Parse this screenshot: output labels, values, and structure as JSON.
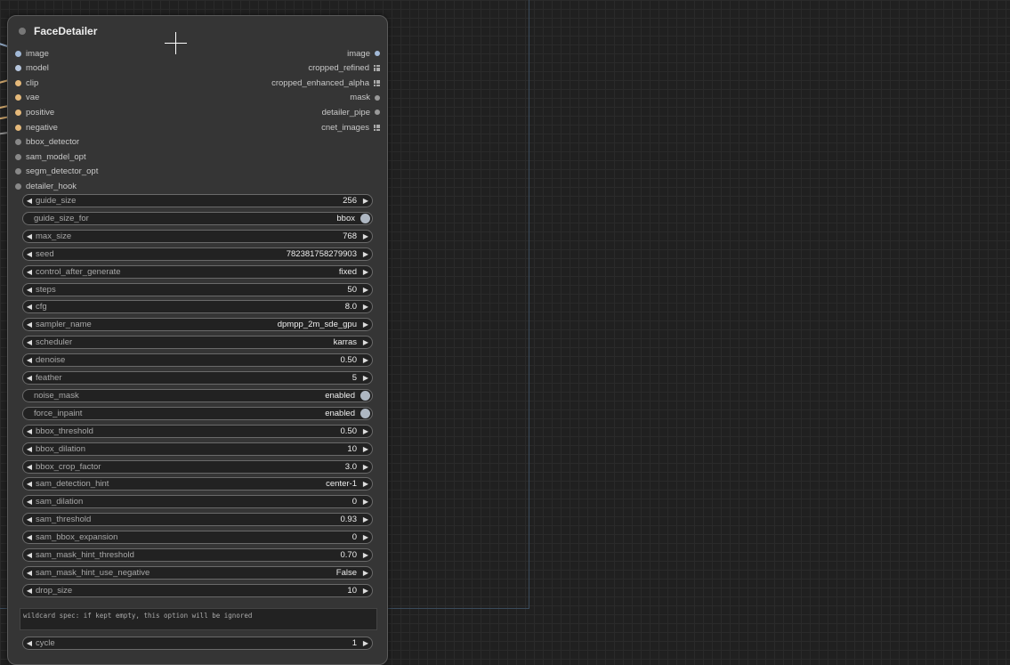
{
  "node": {
    "title": "FaceDetailer",
    "inputs": [
      {
        "label": "image",
        "color": "#a1b8d6"
      },
      {
        "label": "model",
        "color": "#b6c6dd"
      },
      {
        "label": "clip",
        "color": "#e5b97a"
      },
      {
        "label": "vae",
        "color": "#e5b97a"
      },
      {
        "label": "positive",
        "color": "#e5b97a"
      },
      {
        "label": "negative",
        "color": "#e5b97a"
      },
      {
        "label": "bbox_detector",
        "color": "#888888"
      },
      {
        "label": "sam_model_opt",
        "color": "#888888"
      },
      {
        "label": "segm_detector_opt",
        "color": "#888888"
      },
      {
        "label": "detailer_hook",
        "color": "#888888"
      }
    ],
    "outputs": [
      {
        "label": "image",
        "shape": "dot",
        "color": "#a1b8d6"
      },
      {
        "label": "cropped_refined",
        "shape": "grid",
        "color": "#aaaaaa"
      },
      {
        "label": "cropped_enhanced_alpha",
        "shape": "grid",
        "color": "#aaaaaa"
      },
      {
        "label": "mask",
        "shape": "dot",
        "color": "#999999"
      },
      {
        "label": "detailer_pipe",
        "shape": "dot",
        "color": "#999999"
      },
      {
        "label": "cnet_images",
        "shape": "grid",
        "color": "#aaaaaa"
      }
    ],
    "widgets": [
      {
        "label": "guide_size",
        "value": "256",
        "type": "number"
      },
      {
        "label": "guide_size_for",
        "value": "bbox",
        "type": "toggle"
      },
      {
        "label": "max_size",
        "value": "768",
        "type": "number"
      },
      {
        "label": "seed",
        "value": "782381758279903",
        "type": "number"
      },
      {
        "label": "control_after_generate",
        "value": "fixed",
        "type": "combo"
      },
      {
        "label": "steps",
        "value": "50",
        "type": "number"
      },
      {
        "label": "cfg",
        "value": "8.0",
        "type": "number"
      },
      {
        "label": "sampler_name",
        "value": "dpmpp_2m_sde_gpu",
        "type": "combo"
      },
      {
        "label": "scheduler",
        "value": "karras",
        "type": "combo"
      },
      {
        "label": "denoise",
        "value": "0.50",
        "type": "number"
      },
      {
        "label": "feather",
        "value": "5",
        "type": "number"
      },
      {
        "label": "noise_mask",
        "value": "enabled",
        "type": "toggle"
      },
      {
        "label": "force_inpaint",
        "value": "enabled",
        "type": "toggle"
      },
      {
        "label": "bbox_threshold",
        "value": "0.50",
        "type": "number"
      },
      {
        "label": "bbox_dilation",
        "value": "10",
        "type": "number"
      },
      {
        "label": "bbox_crop_factor",
        "value": "3.0",
        "type": "number"
      },
      {
        "label": "sam_detection_hint",
        "value": "center-1",
        "type": "combo"
      },
      {
        "label": "sam_dilation",
        "value": "0",
        "type": "number"
      },
      {
        "label": "sam_threshold",
        "value": "0.93",
        "type": "number"
      },
      {
        "label": "sam_bbox_expansion",
        "value": "0",
        "type": "number"
      },
      {
        "label": "sam_mask_hint_threshold",
        "value": "0.70",
        "type": "number"
      },
      {
        "label": "sam_mask_hint_use_negative",
        "value": "False",
        "type": "combo"
      },
      {
        "label": "drop_size",
        "value": "10",
        "type": "number"
      }
    ],
    "wildcard_placeholder": "wildcard spec: if kept empty, this option will be ignored",
    "cycle": {
      "label": "cycle",
      "value": "1",
      "type": "number"
    }
  },
  "icons": {
    "left_arrow": "◀",
    "right_arrow": "▶"
  }
}
